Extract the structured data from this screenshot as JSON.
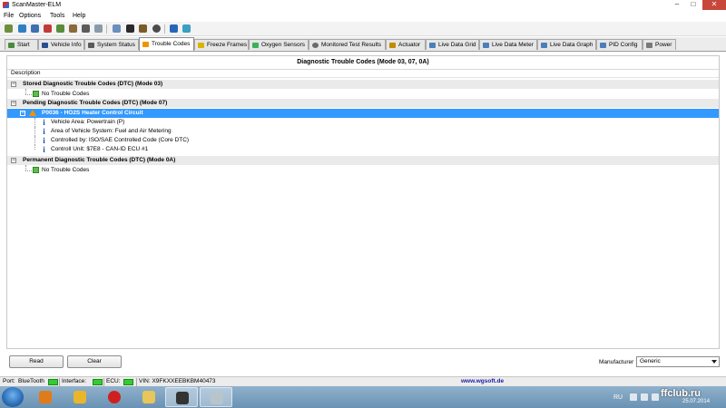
{
  "window": {
    "title": "ScanMaster-ELM"
  },
  "menu": [
    "File",
    "Options",
    "Tools",
    "Help"
  ],
  "tabs": [
    {
      "label": "Start"
    },
    {
      "label": "Vehicle Info"
    },
    {
      "label": "System Status"
    },
    {
      "label": "Trouble Codes"
    },
    {
      "label": "Freeze Frames"
    },
    {
      "label": "Oxygen Sensors"
    },
    {
      "label": "Monitored Test Results"
    },
    {
      "label": "Actuator"
    },
    {
      "label": "Live Data Grid"
    },
    {
      "label": "Live Data Meter"
    },
    {
      "label": "Live Data Graph"
    },
    {
      "label": "PID Config"
    },
    {
      "label": "Power"
    }
  ],
  "panel": {
    "header": "Diagnostic Trouble Codes (Mode 03, 07, 0A)",
    "column": "Description",
    "stored": {
      "title": "Stored Diagnostic Trouble Codes (DTC) (Mode 03)",
      "item": "No Trouble Codes"
    },
    "pending": {
      "title": "Pending Diagnostic Trouble Codes (DTC) (Mode 07)",
      "code": "P0036 - HO2S Heater Control Circuit",
      "details": [
        "Vehicle Area: Powertrain (P)",
        "Area of Vehicle System: Fuel and Air Metering",
        "Controlled by: ISO/SAE Controlled Code (Core DTC)",
        "Controll Unit: $7E8 - CAN-ID ECU #1"
      ]
    },
    "permanent": {
      "title": "Permanent Diagnostic Trouble Codes (DTC) (Mode 0A)",
      "item": "No Trouble Codes"
    }
  },
  "buttons": {
    "read": "Read",
    "clear": "Clear"
  },
  "manufacturer": {
    "label": "Manufacturer",
    "value": "Generic"
  },
  "status": {
    "port": "Port:",
    "port_value": "BlueTooth",
    "interface": "Interface:",
    "ecu": "ECU:",
    "vin": "VIN: X9FKXXEEBKBM40473",
    "url": "www.wgsoft.de"
  },
  "taskbar": {
    "lang": "RU",
    "date": "25.07.2014",
    "watermark": "ffclub.ru"
  }
}
